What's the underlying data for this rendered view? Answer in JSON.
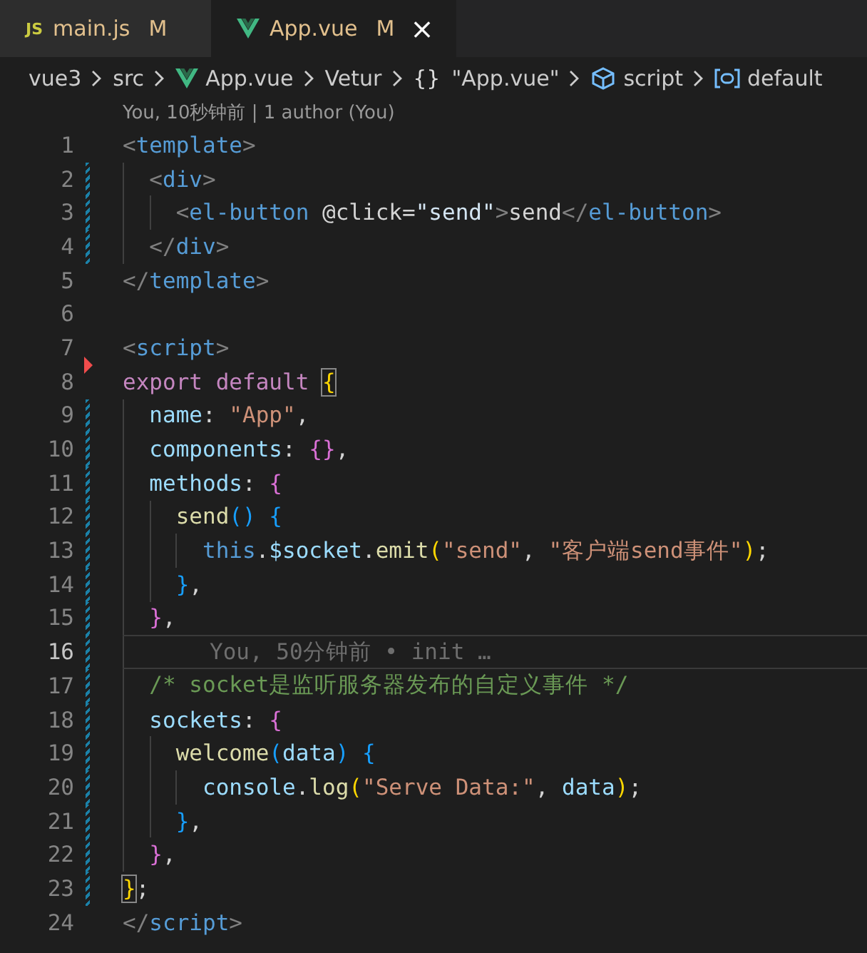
{
  "tabs": [
    {
      "kind": "js",
      "icon_text": "JS",
      "label": "main.js",
      "badge": "M",
      "selected": false
    },
    {
      "kind": "vue",
      "label": "App.vue",
      "badge": "M",
      "selected": true,
      "close": "×"
    }
  ],
  "breadcrumbs": [
    {
      "kind": "plain",
      "label": "vue3"
    },
    {
      "kind": "plain",
      "label": "src"
    },
    {
      "kind": "vue",
      "label": "App.vue"
    },
    {
      "kind": "plain",
      "label": "Vetur"
    },
    {
      "kind": "glyph",
      "icon_text": "{}",
      "label": "\"App.vue\""
    },
    {
      "kind": "cube",
      "label": "script"
    },
    {
      "kind": "field",
      "label": "default"
    }
  ],
  "codelens": "You, 10秒钟前 | 1 author (You)",
  "lines": [
    {
      "number": "1",
      "modified": false,
      "deleted": false,
      "current": false,
      "tokens": [
        {
          "kind": "punct",
          "text": "<"
        },
        {
          "kind": "tag",
          "text": "template"
        },
        {
          "kind": "punct",
          "text": ">"
        }
      ]
    },
    {
      "number": "2",
      "modified": true,
      "deleted": false,
      "current": false,
      "tokens": [
        {
          "kind": "punct",
          "text": "  <"
        },
        {
          "kind": "tag",
          "text": "div"
        },
        {
          "kind": "punct",
          "text": ">"
        }
      ]
    },
    {
      "number": "3",
      "modified": true,
      "deleted": false,
      "current": false,
      "tokens": [
        {
          "kind": "punct",
          "text": "    <"
        },
        {
          "kind": "tag",
          "text": "el-button "
        },
        {
          "kind": "text",
          "text": "@click="
        },
        {
          "kind": "attrval",
          "text": "\"send\""
        },
        {
          "kind": "punct",
          "text": ">"
        },
        {
          "kind": "text",
          "text": "send"
        },
        {
          "kind": "punct",
          "text": "</"
        },
        {
          "kind": "tag",
          "text": "el-button"
        },
        {
          "kind": "punct",
          "text": ">"
        }
      ]
    },
    {
      "number": "4",
      "modified": true,
      "deleted": false,
      "current": false,
      "tokens": [
        {
          "kind": "punct",
          "text": "  </"
        },
        {
          "kind": "tag",
          "text": "div"
        },
        {
          "kind": "punct",
          "text": ">"
        }
      ]
    },
    {
      "number": "5",
      "modified": false,
      "deleted": false,
      "current": false,
      "tokens": [
        {
          "kind": "punct",
          "text": "</"
        },
        {
          "kind": "tag",
          "text": "template"
        },
        {
          "kind": "punct",
          "text": ">"
        }
      ]
    },
    {
      "number": "6",
      "modified": false,
      "deleted": false,
      "current": false
    },
    {
      "number": "7",
      "modified": false,
      "deleted": false,
      "current": false,
      "tokens": [
        {
          "kind": "punct",
          "text": "<"
        },
        {
          "kind": "tag",
          "text": "script"
        },
        {
          "kind": "punct",
          "text": ">"
        }
      ]
    },
    {
      "number": "8",
      "modified": false,
      "deleted": true,
      "current": false,
      "tokens": [
        {
          "kind": "keyword",
          "text": "export default "
        },
        {
          "kind": "brace1box",
          "text": "{"
        }
      ]
    },
    {
      "number": "9",
      "modified": true,
      "deleted": false,
      "current": false,
      "tokens": [
        {
          "kind": "prop",
          "text": "  name"
        },
        {
          "kind": "text",
          "text": ": "
        },
        {
          "kind": "string",
          "text": "\"App\""
        },
        {
          "kind": "text",
          "text": ","
        }
      ]
    },
    {
      "number": "10",
      "modified": true,
      "deleted": false,
      "current": false,
      "tokens": [
        {
          "kind": "prop",
          "text": "  components"
        },
        {
          "kind": "text",
          "text": ": "
        },
        {
          "kind": "brace2",
          "text": "{}"
        },
        {
          "kind": "text",
          "text": ","
        }
      ]
    },
    {
      "number": "11",
      "modified": true,
      "deleted": false,
      "current": false,
      "tokens": [
        {
          "kind": "prop",
          "text": "  methods"
        },
        {
          "kind": "text",
          "text": ": "
        },
        {
          "kind": "brace2",
          "text": "{"
        }
      ]
    },
    {
      "number": "12",
      "modified": true,
      "deleted": false,
      "current": false,
      "tokens": [
        {
          "kind": "func",
          "text": "    send"
        },
        {
          "kind": "brace3",
          "text": "() {"
        }
      ]
    },
    {
      "number": "13",
      "modified": true,
      "deleted": false,
      "current": false,
      "tokens": [
        {
          "kind": "this",
          "text": "      this"
        },
        {
          "kind": "text",
          "text": "."
        },
        {
          "kind": "prop",
          "text": "$socket"
        },
        {
          "kind": "text",
          "text": "."
        },
        {
          "kind": "func",
          "text": "emit"
        },
        {
          "kind": "brace1",
          "text": "("
        },
        {
          "kind": "string",
          "text": "\"send\""
        },
        {
          "kind": "text",
          "text": ", "
        },
        {
          "kind": "string",
          "text": "\"客户端send事件\""
        },
        {
          "kind": "brace1",
          "text": ")"
        },
        {
          "kind": "text",
          "text": ";"
        }
      ]
    },
    {
      "number": "14",
      "modified": true,
      "deleted": false,
      "current": false,
      "tokens": [
        {
          "kind": "brace3",
          "text": "    }"
        },
        {
          "kind": "text",
          "text": ","
        }
      ]
    },
    {
      "number": "15",
      "modified": true,
      "deleted": false,
      "current": false,
      "tokens": [
        {
          "kind": "brace2",
          "text": "  }"
        },
        {
          "kind": "text",
          "text": ","
        }
      ]
    },
    {
      "number": "16",
      "modified": true,
      "deleted": false,
      "current": true,
      "blame": "You, 50分钟前 • init …"
    },
    {
      "number": "17",
      "modified": true,
      "deleted": false,
      "current": false,
      "tokens": [
        {
          "kind": "comment",
          "text": "  /* socket是监听服务器发布的自定义事件 */"
        }
      ]
    },
    {
      "number": "18",
      "modified": true,
      "deleted": false,
      "current": false,
      "tokens": [
        {
          "kind": "prop",
          "text": "  sockets"
        },
        {
          "kind": "text",
          "text": ": "
        },
        {
          "kind": "brace2",
          "text": "{"
        }
      ]
    },
    {
      "number": "19",
      "modified": true,
      "deleted": false,
      "current": false,
      "tokens": [
        {
          "kind": "func",
          "text": "    welcome"
        },
        {
          "kind": "brace3",
          "text": "("
        },
        {
          "kind": "prop",
          "text": "data"
        },
        {
          "kind": "brace3",
          "text": ") {"
        }
      ]
    },
    {
      "number": "20",
      "modified": true,
      "deleted": false,
      "current": false,
      "tokens": [
        {
          "kind": "prop",
          "text": "      console"
        },
        {
          "kind": "text",
          "text": "."
        },
        {
          "kind": "func",
          "text": "log"
        },
        {
          "kind": "brace1",
          "text": "("
        },
        {
          "kind": "string",
          "text": "\"Serve Data:\""
        },
        {
          "kind": "text",
          "text": ", "
        },
        {
          "kind": "prop",
          "text": "data"
        },
        {
          "kind": "brace1",
          "text": ")"
        },
        {
          "kind": "text",
          "text": ";"
        }
      ]
    },
    {
      "number": "21",
      "modified": true,
      "deleted": false,
      "current": false,
      "tokens": [
        {
          "kind": "brace3",
          "text": "    }"
        },
        {
          "kind": "text",
          "text": ","
        }
      ]
    },
    {
      "number": "22",
      "modified": true,
      "deleted": false,
      "current": false,
      "tokens": [
        {
          "kind": "brace2",
          "text": "  }"
        },
        {
          "kind": "text",
          "text": ","
        }
      ]
    },
    {
      "number": "23",
      "modified": true,
      "deleted": false,
      "current": false,
      "tokens": [
        {
          "kind": "brace1box",
          "text": "}"
        },
        {
          "kind": "text",
          "text": ";"
        }
      ]
    },
    {
      "number": "24",
      "modified": false,
      "deleted": false,
      "current": false,
      "tokens": [
        {
          "kind": "punct",
          "text": "</"
        },
        {
          "kind": "tag",
          "text": "script"
        },
        {
          "kind": "punct",
          "text": ">"
        }
      ]
    }
  ]
}
